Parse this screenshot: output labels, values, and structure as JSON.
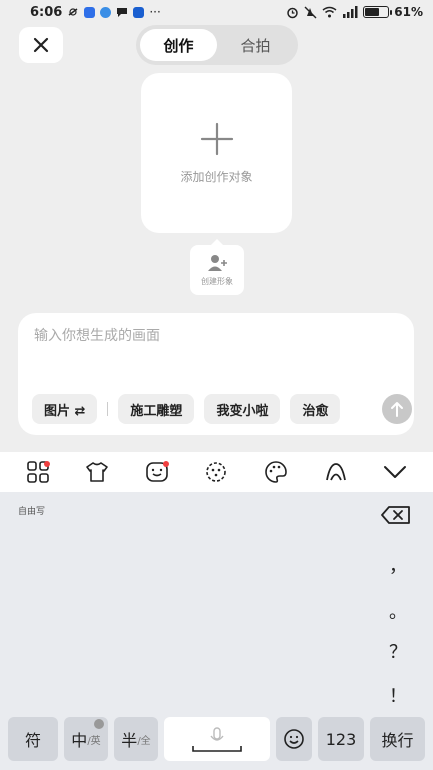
{
  "status_bar": {
    "time": "6:06",
    "dots": "···",
    "battery_text": "61%",
    "battery_level": 0.61
  },
  "header": {
    "tabs": [
      {
        "label": "创作",
        "active": true
      },
      {
        "label": "合拍",
        "active": false
      }
    ]
  },
  "target_card": {
    "label": "添加创作对象"
  },
  "create_avatar": {
    "label": "创建形象"
  },
  "input": {
    "placeholder": "输入你想生成的画面",
    "chips": [
      {
        "label": "图片 ⇄"
      },
      {
        "label": "施工雕塑"
      },
      {
        "label": "我变小啦"
      },
      {
        "label": "治愈"
      }
    ]
  },
  "keyboard": {
    "mode_label": "自由写",
    "punctuation": [
      "，",
      "。",
      "？",
      "！"
    ],
    "keys": {
      "symbols": "符",
      "zh_main": "中",
      "zh_sub": "/英",
      "half_main": "半",
      "half_sub": "/全",
      "numbers": "123",
      "enter": "换行"
    }
  },
  "colors": {
    "background": "#eeeeee",
    "card": "#ffffff",
    "send_disabled": "#c8c8c8",
    "badge_red": "#f04040",
    "keyboard_bg": "#e9ebef"
  }
}
